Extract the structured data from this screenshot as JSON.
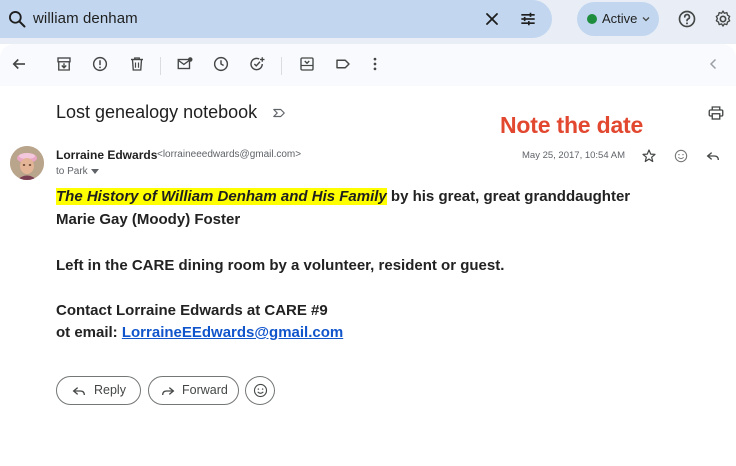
{
  "search": {
    "query": "william denham",
    "icons": [
      "search-icon",
      "clear-icon",
      "search-options-icon"
    ]
  },
  "status": {
    "label": "Active",
    "color": "#1e8e3e"
  },
  "header_icons": [
    "help-icon",
    "settings-icon"
  ],
  "toolbar": {
    "icons": [
      "back-icon",
      "archive-icon",
      "report-spam-icon",
      "delete-icon",
      "mark-unread-icon",
      "snooze-icon",
      "add-to-tasks-icon",
      "move-to-icon",
      "label-icon",
      "more-icon",
      "previous-icon"
    ]
  },
  "email": {
    "subject": "Lost genealogy notebook",
    "annotation": "Note the date",
    "annotation_color": "#e2472f",
    "sender_name": "Lorraine Edwards",
    "sender_email": "<lorraineeedwards@gmail.com>",
    "to": "to Park",
    "date": "May 25, 2017, 10:54 AM",
    "body": {
      "book_title": "The History of William Denham and His Family",
      "line1_rest": " by his great, great granddaughter",
      "line2": "Marie Gay (Moody) Foster",
      "line3": "Left in the CARE dining room by a volunteer, resident or guest.",
      "line4": "Contact Lorraine Edwards at CARE #9",
      "line5_prefix": "ot email: ",
      "email_link": "LorraineEEdwards@gmail.com"
    }
  },
  "actions": {
    "reply": "Reply",
    "forward": "Forward"
  }
}
